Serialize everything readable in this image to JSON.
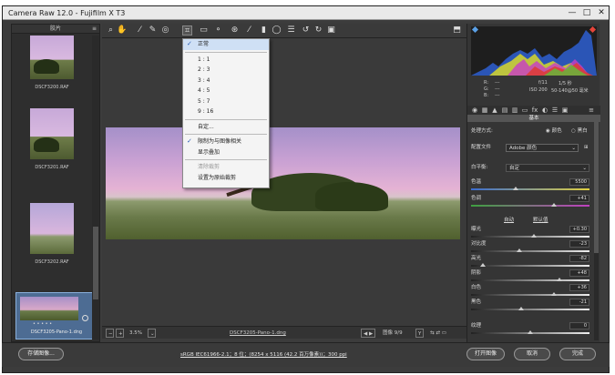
{
  "window": {
    "title": "Camera Raw 12.0 - Fujifilm X T3",
    "min": "—",
    "max": "□",
    "close": "✕"
  },
  "filmstrip": {
    "header": "胶片",
    "items": [
      {
        "caption": "DSCF3200.RAF"
      },
      {
        "caption": "DSCF3201.RAF"
      },
      {
        "caption": "DSCF3202.RAF"
      },
      {
        "caption": "DSCF3205-Pano-1.dng",
        "stars": "• • • • •"
      }
    ]
  },
  "toolbar": {
    "icons": [
      "zoom-icon",
      "hand-icon",
      "white-balance-icon",
      "color-sampler-icon",
      "target-adjust-icon",
      "crop-icon",
      "straighten-icon",
      "spot-removal-icon",
      "red-eye-icon",
      "brush-icon",
      "graduated-filter-icon",
      "radial-filter-icon",
      "presets-icon",
      "rotate-ccw-icon",
      "rotate-cw-icon",
      "delete-icon"
    ],
    "fullscreen": "⬒"
  },
  "crop_menu": {
    "items": [
      {
        "label": "正常",
        "checked": true,
        "highlight": true
      },
      {
        "label": "1 : 1"
      },
      {
        "label": "2 : 3"
      },
      {
        "label": "3 : 4"
      },
      {
        "label": "4 : 5"
      },
      {
        "label": "5 : 7"
      },
      {
        "label": "9 : 16"
      },
      {
        "label": "自定..."
      },
      {
        "label": "限制为与图像相关",
        "checked": true
      },
      {
        "label": "显示叠加"
      },
      {
        "label": "清除裁剪",
        "disabled": true
      },
      {
        "label": "设置为原始裁剪"
      }
    ]
  },
  "statusbar": {
    "zoom": "3.5%",
    "filename": "DSCF3205-Pano-1.dng",
    "counter": "图像 9/9"
  },
  "info": {
    "r": "R:",
    "g": "G:",
    "b": "B:",
    "dash": "---",
    "aperture": "f/11",
    "shutter": "1/5 秒",
    "iso": "ISO 200",
    "lens": "50-140@50 毫米"
  },
  "basic": {
    "section": "基本",
    "treatment_label": "处理方式:",
    "color": "颜色",
    "bw": "黑白",
    "profile_label": "配置文件",
    "profile_value": "Adobe 颜色",
    "wb_label": "白平衡:",
    "wb_value": "自定",
    "temp_label": "色温",
    "temp_value": "5500",
    "tint_label": "色调",
    "tint_value": "+41",
    "auto": "自动",
    "default": "默认值",
    "exposure_label": "曝光",
    "exposure_value": "+0.30",
    "contrast_label": "对比度",
    "contrast_value": "-23",
    "highlights_label": "高光",
    "highlights_value": "-82",
    "shadows_label": "阴影",
    "shadows_value": "+48",
    "whites_label": "白色",
    "whites_value": "+36",
    "blacks_label": "黑色",
    "blacks_value": "-21",
    "texture_label": "纹理",
    "texture_value": "0"
  },
  "bottom": {
    "save": "存储图像...",
    "workflow": "sRGB IEC61966-2.1；8 位；(8254 x 5116 (42.2 百万像素))；300 ppi",
    "open": "打开图像",
    "cancel": "取消",
    "done": "完成"
  }
}
